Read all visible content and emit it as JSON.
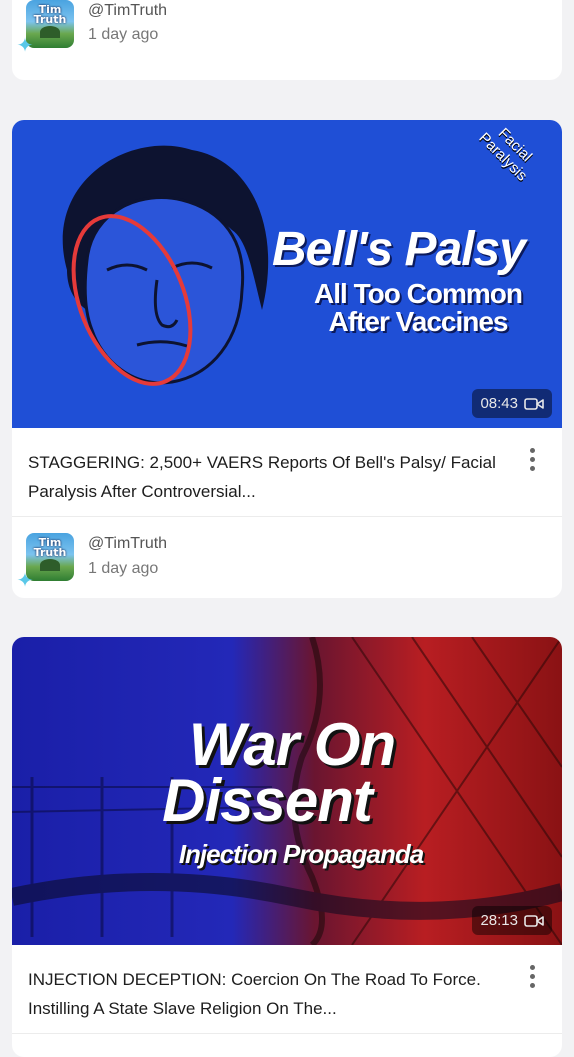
{
  "posts": [
    {
      "handle": "@TimTruth",
      "time": "1 day ago"
    },
    {
      "thumbnail": {
        "headline": "Bell's Palsy",
        "subline_1": "All Too Common",
        "subline_2": "After Vaccines",
        "corner_1": "Facial",
        "corner_2": "Paralysis"
      },
      "duration": "08:43",
      "title": "STAGGERING: 2,500+ VAERS Reports Of Bell's Palsy/ Facial Paralysis After Controversial...",
      "handle": "@TimTruth",
      "time": "1 day ago"
    },
    {
      "thumbnail": {
        "headline_1": "War On",
        "headline_2": "Dissent",
        "subline": "Injection Propaganda"
      },
      "duration": "28:13",
      "title": "INJECTION DECEPTION: Coercion On The Road To Force. Instilling A State Slave Religion On The..."
    }
  ],
  "avatar": {
    "line_1": "Tim",
    "line_2": "Truth"
  },
  "colors": {
    "background": "#f2f2f4",
    "card": "#ffffff",
    "thumb_blue": "#1f4fd6",
    "sparkle": "#5ac8e8"
  },
  "icons": [
    "sparkle-icon",
    "video-camera-icon",
    "more-vertical-icon"
  ]
}
